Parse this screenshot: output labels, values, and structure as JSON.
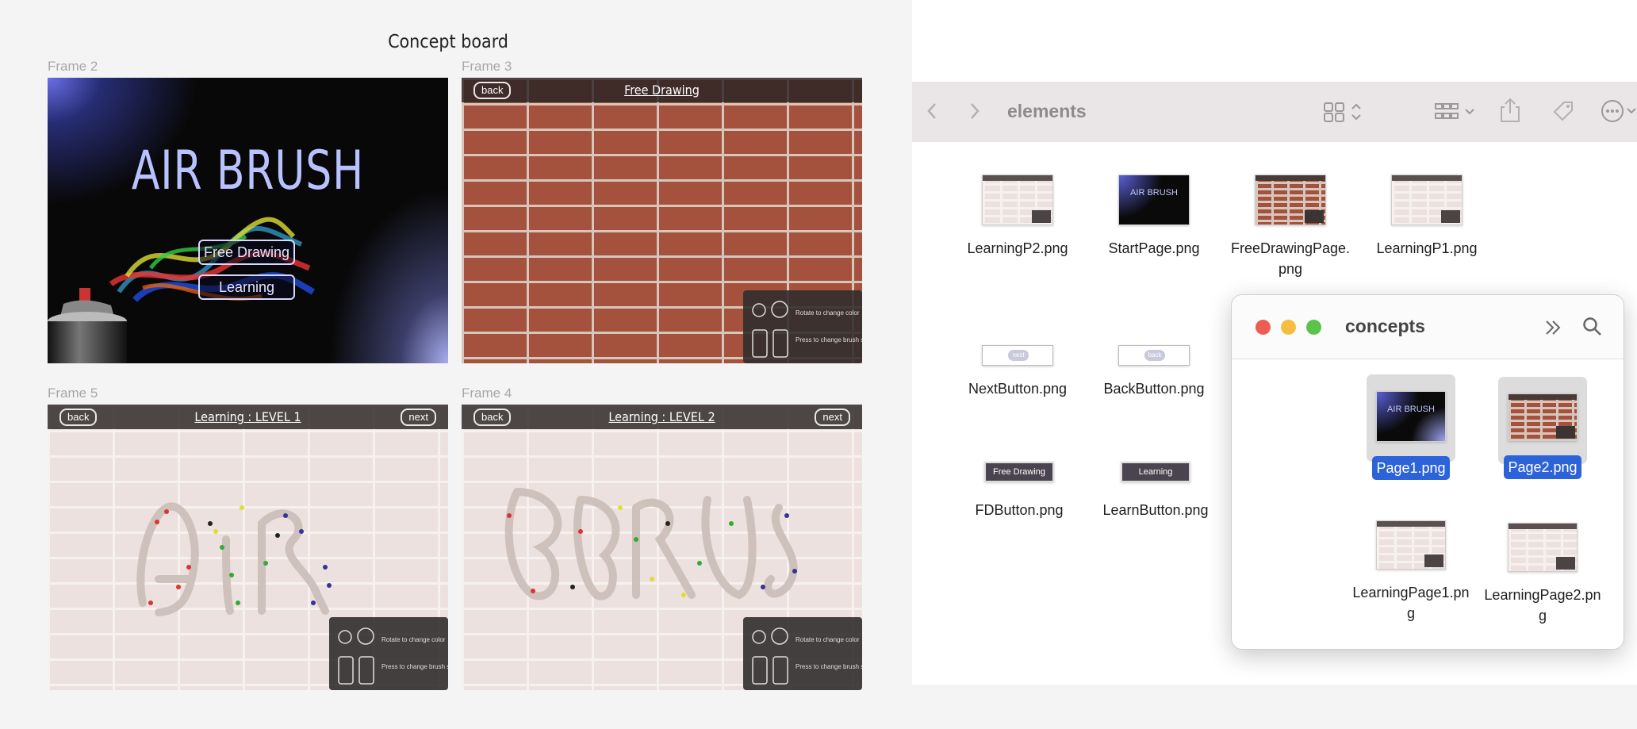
{
  "board": {
    "title": "Concept board",
    "frames": {
      "f2": "Frame 2",
      "f3": "Frame 3",
      "f5": "Frame 5",
      "f4": "Frame 4"
    }
  },
  "start_page": {
    "title": "AIR BRUSH",
    "free_drawing_button": "Free Drawing",
    "learning_button": "Learning"
  },
  "free_drawing_page": {
    "back": "back",
    "title": "Free Drawing"
  },
  "learning1": {
    "back": "back",
    "title": "Learning : LEVEL 1",
    "next": "next"
  },
  "learning2": {
    "back": "back",
    "title": "Learning : LEVEL 2",
    "next": "next"
  },
  "hint": {
    "rotate": "Rotate to change color",
    "press": "Press to change brush size"
  },
  "finder": {
    "folder": "elements",
    "files": [
      "LearningP2.png",
      "StartPage.png",
      "FreeDrawingPage.\npng",
      "LearningP1.png",
      "NextButton.png",
      "BackButton.png",
      "FDButton.png",
      "LearnButton.png"
    ],
    "thumb_labels": {
      "air": "AIR BRUSH",
      "next": "next",
      "back": "back",
      "fd": "Free Drawing",
      "learn": "Learning"
    }
  },
  "concepts": {
    "title": "concepts",
    "files": [
      "Page1.png",
      "Page2.png",
      "LearningPage1.pn\ng",
      "LearningPage2.pn\ng"
    ]
  },
  "colors": {
    "accent": "#2d63d8",
    "brick": "#a4523d",
    "traffic_red": "#ee5d53",
    "traffic_yellow": "#f5be3f",
    "traffic_green": "#5ac34b"
  }
}
